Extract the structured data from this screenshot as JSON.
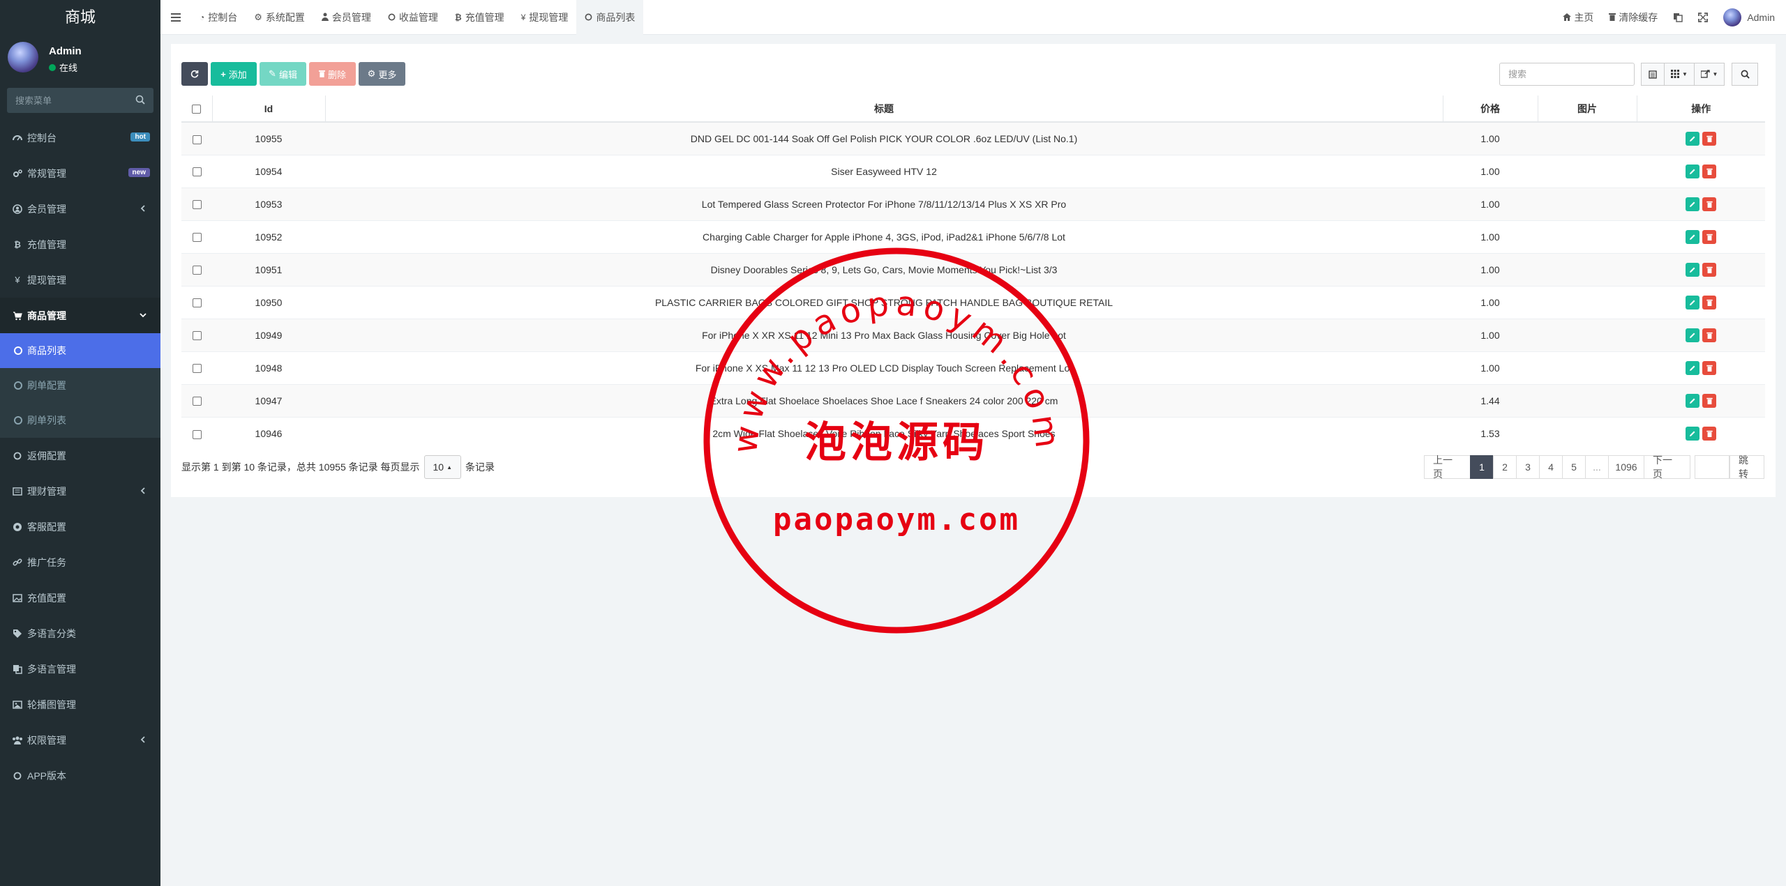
{
  "app": {
    "title": "商城"
  },
  "user": {
    "name": "Admin",
    "status": "在线"
  },
  "sidebar": {
    "search_placeholder": "搜索菜单",
    "items": [
      {
        "label": "控制台",
        "badge": "hot",
        "badge_color": "#3c8dbc"
      },
      {
        "label": "常规管理",
        "badge": "new",
        "badge_color": "#605ca8"
      },
      {
        "label": "会员管理"
      },
      {
        "label": "充值管理"
      },
      {
        "label": "提现管理"
      },
      {
        "label": "商品管理"
      },
      {
        "label": "返佣配置"
      },
      {
        "label": "理财管理"
      },
      {
        "label": "客服配置"
      },
      {
        "label": "推广任务"
      },
      {
        "label": "充值配置"
      },
      {
        "label": "多语言分类"
      },
      {
        "label": "多语言管理"
      },
      {
        "label": "轮播图管理"
      },
      {
        "label": "权限管理"
      },
      {
        "label": "APP版本"
      }
    ],
    "submenu": [
      {
        "label": "商品列表"
      },
      {
        "label": "刷单配置"
      },
      {
        "label": "刷单列表"
      }
    ]
  },
  "topnav": {
    "tabs": [
      {
        "label": "控制台",
        "icon": "dashboard-icon"
      },
      {
        "label": "系统配置",
        "icon": "gear-icon"
      },
      {
        "label": "会员管理",
        "icon": "user-icon"
      },
      {
        "label": "收益管理",
        "icon": "circle-icon"
      },
      {
        "label": "充值管理",
        "icon": "bitcoin-icon"
      },
      {
        "label": "提现管理",
        "icon": "yen-icon"
      },
      {
        "label": "商品列表",
        "icon": "circle-icon"
      }
    ],
    "home": "主页",
    "clear_cache": "清除缓存",
    "admin": "Admin"
  },
  "toolbar": {
    "add": "添加",
    "edit": "编辑",
    "delete": "删除",
    "more": "更多",
    "search_placeholder": "搜索"
  },
  "table": {
    "headers": {
      "id": "Id",
      "title": "标题",
      "price": "价格",
      "image": "图片",
      "ops": "操作"
    },
    "rows": [
      {
        "id": "10955",
        "title": "DND GEL DC 001-144 Soak Off Gel Polish PICK YOUR COLOR .6oz LED/UV (List No.1)",
        "price": "1.00"
      },
      {
        "id": "10954",
        "title": "Siser Easyweed HTV 12",
        "price": "1.00"
      },
      {
        "id": "10953",
        "title": "Lot Tempered Glass Screen Protector For iPhone 7/8/11/12/13/14 Plus X XS XR Pro",
        "price": "1.00"
      },
      {
        "id": "10952",
        "title": "Charging Cable Charger for Apple iPhone 4, 3GS, iPod, iPad2&1 iPhone 5/6/7/8 Lot",
        "price": "1.00"
      },
      {
        "id": "10951",
        "title": "Disney Doorables Series 8, 9, Lets Go, Cars, Movie Moments You Pick!~List 3/3",
        "price": "1.00"
      },
      {
        "id": "10950",
        "title": "PLASTIC CARRIER BAGS COLORED GIFT SHOP STRONG PATCH HANDLE BAG BOUTIQUE RETAIL",
        "price": "1.00"
      },
      {
        "id": "10949",
        "title": "For iPhone X XR XS 11 12 Mini 13 Pro Max Back Glass Housing Cover Big Hole Lot",
        "price": "1.00"
      },
      {
        "id": "10948",
        "title": "For iPhone X XS Max 11 12 13 Pro OLED LCD Display Touch Screen Replacement Lot",
        "price": "1.00"
      },
      {
        "id": "10947",
        "title": "Extra Long Flat Shoelace Shoelaces Shoe Lace f Sneakers 24 color 200 220 cm",
        "price": "1.44"
      },
      {
        "id": "10946",
        "title": "2cm Wide Flat Shoelaces Voile Ribbon Lace Silky Yarn Shoelaces Sport Shoes",
        "price": "1.53"
      }
    ]
  },
  "pagination": {
    "info_prefix": "显示第 1 到第 10 条记录，总共 10955 条记录 每页显示",
    "page_size": "10",
    "info_suffix": "条记录",
    "prev": "上一页",
    "pages": [
      "1",
      "2",
      "3",
      "4",
      "5",
      "...",
      "1096"
    ],
    "next": "下一页",
    "jump": "跳转"
  },
  "watermark": {
    "arc_text": "www.paopaoym.com",
    "center_text": "泡泡源码",
    "bottom_text": "paopaoym.com",
    "color": "#e60012"
  }
}
